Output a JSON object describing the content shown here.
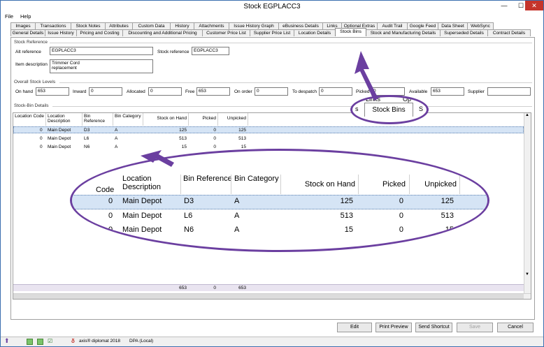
{
  "window": {
    "title": "Stock EGPLACC3",
    "minimize": "—",
    "maximize": "☐",
    "close": "✕"
  },
  "menu": [
    "File",
    "Help"
  ],
  "tabs_row1": [
    "Images",
    "Transactions",
    "Stock Notes",
    "Attributes",
    "Custom Data",
    "History",
    "Attachments",
    "Issue History Graph",
    "eBusiness Details",
    "Links",
    "Optional Extras",
    "Audit Trail",
    "Google Feed",
    "Data Sheet",
    "WebSync"
  ],
  "tabs_row2": [
    "General Details",
    "Issue History",
    "Pricing and Costing",
    "Discounting and Additional Pricing",
    "Customer Price List",
    "Supplier Price List",
    "Location Details",
    "Stock Bins",
    "Stock and Manufacturing Details",
    "Superseded Details",
    "Contract Details"
  ],
  "stock_reference": {
    "group_label": "Stock Reference",
    "alt_reference_label": "Alt reference",
    "alt_reference_value": "EGPLACC3",
    "stock_reference_label": "Stock reference",
    "stock_reference_value": "EGPLACC3",
    "item_description_label": "Item description",
    "item_description_line1": "Trimmer Cord",
    "item_description_line2": "replacement"
  },
  "stock_levels": {
    "group_label": "Overall Stock Levels",
    "on_hand_label": "On hand",
    "on_hand": "653",
    "inward_label": "Inward",
    "inward": "0",
    "allocated_label": "Allocated",
    "allocated": "0",
    "free_label": "Free",
    "free": "653",
    "on_order_label": "On order",
    "on_order": "0",
    "to_despatch_label": "To despatch",
    "to_despatch": "0",
    "picked_label": "Picked",
    "picked": "0",
    "available_label": "Available",
    "available": "653",
    "supplier_label": "Supplier",
    "supplier": ""
  },
  "stock_bin_details": {
    "group_label": "Stock-Bin Details",
    "headers": {
      "location_code": "Location Code",
      "location_description": "Location Description",
      "bin_reference": "Bin Reference",
      "bin_category": "Bin Category",
      "stock_on_hand": "Stock on Hand",
      "picked": "Picked",
      "unpicked": "Unpicked"
    },
    "rows": [
      {
        "location_code": "0",
        "location_description": "Main Depot",
        "bin_reference": "D3",
        "bin_category": "A",
        "stock_on_hand": "125",
        "picked": "0",
        "unpicked": "125"
      },
      {
        "location_code": "0",
        "location_description": "Main Depot",
        "bin_reference": "L6",
        "bin_category": "A",
        "stock_on_hand": "513",
        "picked": "0",
        "unpicked": "513"
      },
      {
        "location_code": "0",
        "location_description": "Main Depot",
        "bin_reference": "N6",
        "bin_category": "A",
        "stock_on_hand": "15",
        "picked": "0",
        "unpicked": "15"
      }
    ],
    "totals": {
      "stock_on_hand": "653",
      "picked": "0",
      "unpicked": "653"
    }
  },
  "zoom_callout": {
    "headers": {
      "code": "Code",
      "location_description": "Location Description",
      "bin_reference": "Bin Reference",
      "bin_category": "Bin Category",
      "stock_on_hand": "Stock on Hand",
      "picked": "Picked",
      "unpicked": "Unpicked"
    }
  },
  "tab_callout": {
    "tab_label": "Stock Bins",
    "left_fragment": "s",
    "right_fragment": "S",
    "top_fragment_left": "Links",
    "top_fragment_right": "Op"
  },
  "buttons": {
    "edit": "Edit",
    "print_preview": "Print Preview",
    "send_shortcut": "Send Shortcut",
    "save": "Save",
    "cancel": "Cancel"
  },
  "statusbar": {
    "product": "axis® diplomat 2018",
    "database": "DPA (Local)"
  },
  "colors": {
    "callout": "#6b3fa0",
    "selection": "#d5e4f5",
    "close": "#c5342b"
  }
}
